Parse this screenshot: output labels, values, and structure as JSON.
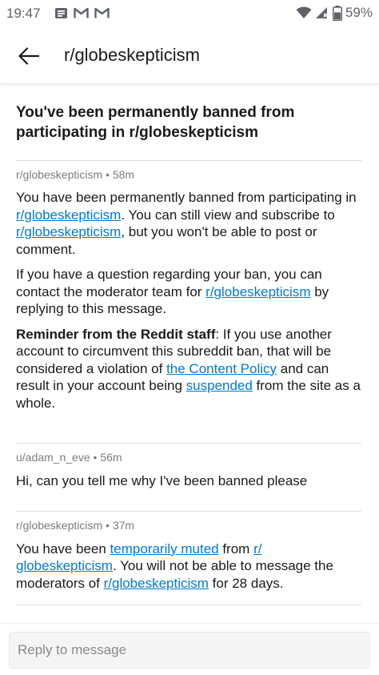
{
  "status_bar": {
    "time": "19:47",
    "battery": "59%",
    "notification_icons": [
      "message-icon",
      "gmail-icon",
      "gmail-icon"
    ]
  },
  "header": {
    "title": "r/globeskepticism"
  },
  "thread": {
    "subject": "You've been permanently banned from participating in r/globeskepticism",
    "messages": [
      {
        "author": "r/globeskepticism",
        "sep": "•",
        "time": "58m",
        "p1": {
          "t1": "You have been permanently banned from participating in ",
          "l1": "r/globeskepticism",
          "t2": ". You can still view and subscribe to ",
          "l2": "r/globeskepticism",
          "t3": ", but you won't be able to post or comment."
        },
        "p2": {
          "t1": "If you have a question regarding your ban, you can contact the moderator team for ",
          "l1": "r/globeskepticism",
          "t2": " by replying to this message."
        },
        "p3": {
          "bold": "Reminder from the Reddit staff",
          "t1": ": If you use another account to circumvent this subreddit ban, that will be considered a violation of ",
          "l1": "the Content Policy",
          "t2": " and can result in your account being ",
          "l2": "suspended",
          "t3": " from the site as a whole."
        }
      },
      {
        "author": "u/adam_n_eve",
        "sep": "•",
        "time": "56m",
        "body": "Hi, can you tell me why I've been banned please"
      },
      {
        "author": "r/globeskepticism",
        "sep": "•",
        "time": "37m",
        "p1": {
          "t1": "You have been ",
          "l1": "temporarily muted",
          "t2": " from ",
          "l2": "r/ globeskepticism",
          "t3": ". You will not be able to message the moderators of ",
          "l3": "r/globeskepticism",
          "t4": " for 28 days."
        }
      }
    ]
  },
  "reply": {
    "placeholder": "Reply to message"
  },
  "colors": {
    "link": "#0079d3",
    "meta": "#7c7c7c",
    "text": "#1a1a1b",
    "divider": "#dcdcdc"
  }
}
